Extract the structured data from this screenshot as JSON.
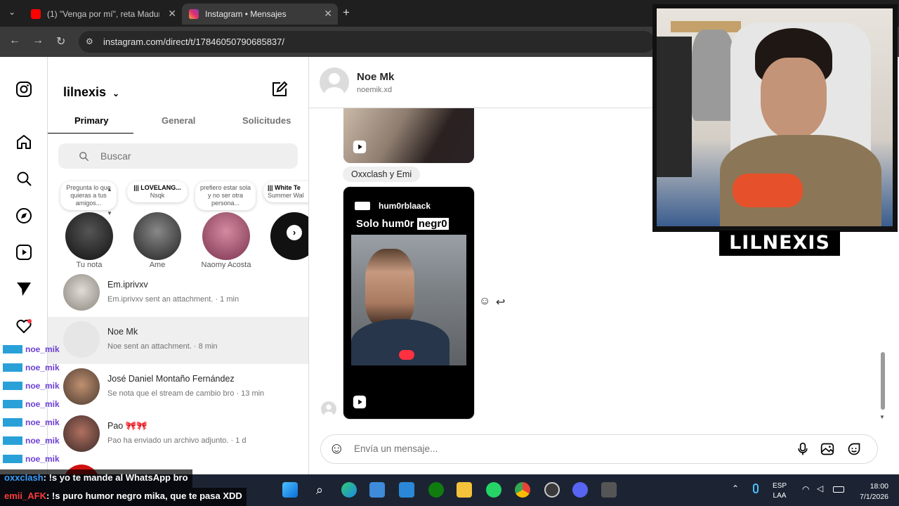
{
  "browser": {
    "tabs": [
      {
        "title": "(1) \"Venga por mí\", reta Maduro",
        "favicon": "youtube-icon"
      },
      {
        "title": "Instagram • Mensajes",
        "favicon": "instagram-icon"
      }
    ],
    "new_tab": "+",
    "url": "instagram.com/direct/t/17846050790685837/"
  },
  "rail": {
    "icons": [
      "instagram-logo-icon",
      "home-icon",
      "search-icon",
      "explore-icon",
      "reels-icon",
      "messages-icon",
      "heart-icon"
    ]
  },
  "inbox": {
    "username": "lilnexis",
    "tabs": [
      "Primary",
      "General",
      "Solicitudes"
    ],
    "search_placeholder": "Buscar",
    "notes": [
      {
        "bubble": "Pregunta lo que quieras a tus amigos...",
        "name": "Tu nota"
      },
      {
        "bubble_title": "||| LOVELANG...",
        "bubble_sub": "Nsqk",
        "name": "Ame"
      },
      {
        "bubble": "prefiero estar sola y no ser otra persona...",
        "name": "Naomy Acosta"
      },
      {
        "bubble_title": "||| White Te",
        "bubble_sub": "Summer Wal",
        "name": ""
      }
    ],
    "conversations": [
      {
        "name": "Em.iprivxv",
        "preview": "Em.iprivxv sent an attachment. · 1 min"
      },
      {
        "name": "Noe Mk",
        "preview": "Noe sent an attachment. · 8 min"
      },
      {
        "name": "José Daniel Montaño Fernández",
        "preview": "Se nota que el stream de cambio bro · 13 min"
      },
      {
        "name": "Pao 🎀🎀",
        "preview": "Pao ha enviado un archivo adjunto. · 1 d"
      }
    ]
  },
  "chat": {
    "name": "Noe Mk",
    "handle": "noemik.xd",
    "reply_label": "Oxxclash y Emi",
    "reel": {
      "user": "hum0rblaack",
      "caption_a": "Solo hum0r ",
      "caption_b": "negr0"
    },
    "input_placeholder": "Envía un mensaje..."
  },
  "webcam": {
    "label": "LILNEXIS"
  },
  "stream_chat": {
    "repeated_user": "noe_mik",
    "rows": 7,
    "message1_user": "oxxclash",
    "message1_text": ": !s yo te mande al WhatsApp bro",
    "message2_user": "emii_AFK",
    "message2_text": ": !s puro humor negro mika, que te pasa XDD"
  },
  "taskbar": {
    "lang_a": "ESP",
    "lang_b": "LAA",
    "time": "18:00",
    "date": "7/1/2026"
  },
  "colors": {
    "accent_instagram": "#e1306c",
    "stream_user": "#6b3fd6",
    "taskbar_bg": "#1c2433"
  }
}
